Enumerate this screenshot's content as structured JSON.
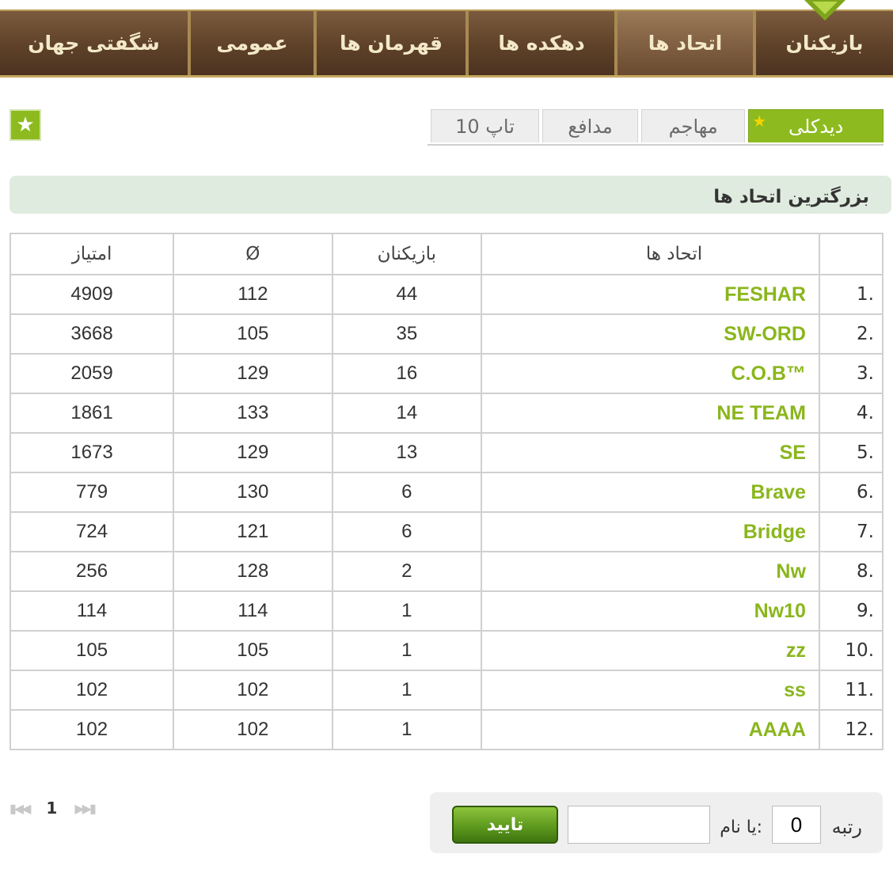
{
  "nav": {
    "items": [
      {
        "label": "بازیکنان"
      },
      {
        "label": "اتحاد ها"
      },
      {
        "label": "دهکده ها"
      },
      {
        "label": "قهرمان ها"
      },
      {
        "label": "عمومی"
      },
      {
        "label": "شگفتی جهان"
      }
    ],
    "active_index": 1
  },
  "tabs": [
    {
      "label": "دیدکلی"
    },
    {
      "label": "مهاجم"
    },
    {
      "label": "مدافع"
    },
    {
      "label": "تاپ 10"
    }
  ],
  "section": {
    "title": "بزرگترین اتحاد ها"
  },
  "table": {
    "headers": {
      "rank": "",
      "alliance": "اتحاد ها",
      "players": "بازیکنان",
      "avg": "Ø",
      "points": "امتیاز"
    },
    "rows": [
      {
        "rank": "1.",
        "name": "FESHAR",
        "players": "44",
        "avg": "112",
        "points": "4909"
      },
      {
        "rank": "2.",
        "name": "SW-ORD",
        "players": "35",
        "avg": "105",
        "points": "3668"
      },
      {
        "rank": "3.",
        "name": "C.O.B™",
        "players": "16",
        "avg": "129",
        "points": "2059"
      },
      {
        "rank": "4.",
        "name": "NE TEAM",
        "players": "14",
        "avg": "133",
        "points": "1861"
      },
      {
        "rank": "5.",
        "name": "SE",
        "players": "13",
        "avg": "129",
        "points": "1673"
      },
      {
        "rank": "6.",
        "name": "Brave",
        "players": "6",
        "avg": "130",
        "points": "779"
      },
      {
        "rank": "7.",
        "name": "Bridge",
        "players": "6",
        "avg": "121",
        "points": "724"
      },
      {
        "rank": "8.",
        "name": "Nw",
        "players": "2",
        "avg": "128",
        "points": "256"
      },
      {
        "rank": "9.",
        "name": "Nw10",
        "players": "1",
        "avg": "114",
        "points": "114"
      },
      {
        "rank": "10.",
        "name": "zz",
        "players": "1",
        "avg": "105",
        "points": "105"
      },
      {
        "rank": "11.",
        "name": "ss",
        "players": "1",
        "avg": "102",
        "points": "102"
      },
      {
        "rank": "12.",
        "name": "AAAA",
        "players": "1",
        "avg": "102",
        "points": "102"
      }
    ]
  },
  "pagination": {
    "first_icon": "first-page-icon",
    "prev_icon": "prev-page-icon",
    "current": "1",
    "next_icon": "next-page-icon",
    "last_icon": "last-page-icon"
  },
  "search": {
    "rank_label": "رتبه",
    "rank_value": "0",
    "name_label": "یا نام:",
    "name_value": "",
    "submit_label": "تایید"
  },
  "colors": {
    "accent": "#8dbb1f",
    "link": "#8ab61c",
    "nav_bg": "#5e4128"
  }
}
